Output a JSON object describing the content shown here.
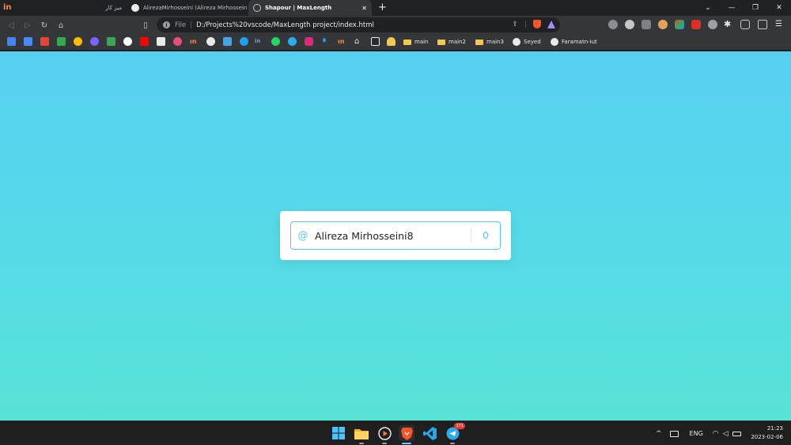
{
  "browser": {
    "pinned_tab_label": "in",
    "tabs": [
      {
        "title": "میز کار"
      },
      {
        "title": "AlirezaMirhosseini (Alireza Mirhosseini)"
      },
      {
        "title": "Shapour | MaxLength"
      }
    ],
    "new_tab_symbol": "+",
    "window_controls": {
      "tab_search": "⌄",
      "minimize": "—",
      "restore": "❐",
      "close": "✕"
    },
    "address": {
      "scheme": "File",
      "url": "D:/Projects%20vscode/MaxLength project/index.html"
    },
    "bookmarks": [
      {
        "label": "main"
      },
      {
        "label": "main2"
      },
      {
        "label": "main3"
      },
      {
        "label": "Seyed"
      },
      {
        "label": "Faramatn-iut"
      }
    ]
  },
  "page": {
    "input": {
      "prefix_symbol": "@",
      "value": "Alireza Mirhosseini8",
      "counter": "0"
    }
  },
  "taskbar": {
    "telegram_badge": "171",
    "tray": {
      "language": "ENG"
    },
    "clock": {
      "time": "21:23",
      "date": "2023-02-06"
    }
  },
  "colors": {
    "accent": "#55c8e6",
    "page_gradient_top": "#58cff2",
    "page_gradient_bottom": "#58e3d6",
    "browser_frame": "#202124",
    "toolbar": "#35363a"
  }
}
